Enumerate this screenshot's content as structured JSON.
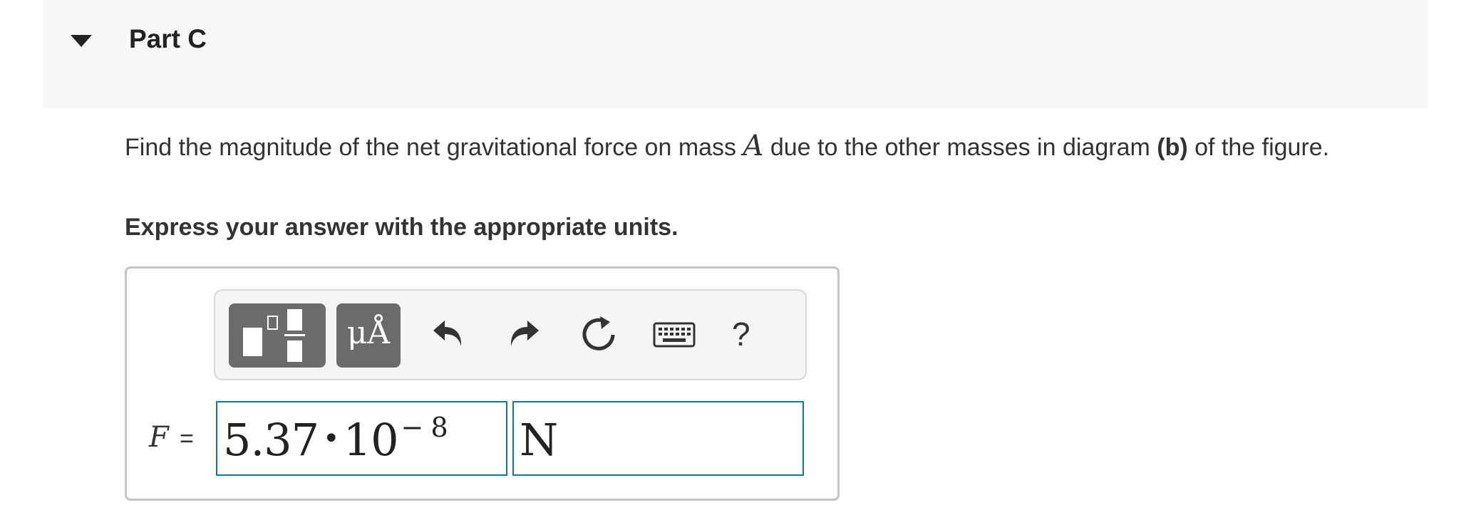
{
  "part": {
    "title": "Part C",
    "collapse_icon": "caret-down-icon"
  },
  "question": {
    "text_before": "Find the magnitude of the net gravitational force on mass ",
    "mass_variable": "A",
    "text_middle": " due to the other masses in diagram ",
    "diagram_label": "(b)",
    "text_after": " of the figure."
  },
  "instruction": "Express your answer with the appropriate units.",
  "toolbar": {
    "templates_icon": "templates-icon",
    "symbols_label": "μÅ",
    "undo_icon": "undo-icon",
    "redo_icon": "redo-icon",
    "reset_icon": "reset-icon",
    "keyboard_icon": "keyboard-icon",
    "help_label": "?"
  },
  "answer": {
    "variable": "F",
    "equals": "=",
    "mantissa": "5.37",
    "multiply": "•",
    "base": "10",
    "exponent": "− 8",
    "unit": "N"
  },
  "colors": {
    "header_bg": "#f7f7f7",
    "toolbar_button_bg": "#6b6b6b",
    "field_border": "#0f7b8a"
  }
}
